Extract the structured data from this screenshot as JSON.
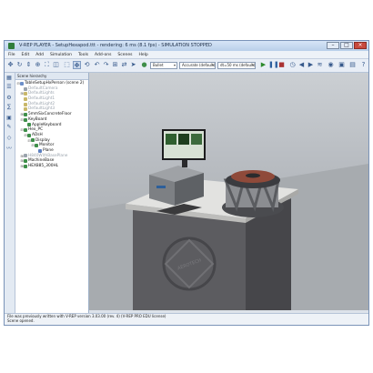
{
  "window": {
    "title": "V-REP PLAYER - SetupHexapod.ttt - rendering: 6 ms (8.1 fps) - SIMULATION STOPPED",
    "controls": [
      "–",
      "□",
      "×"
    ]
  },
  "menu": {
    "items": [
      "File",
      "Edit",
      "Add",
      "Simulation",
      "Tools",
      "Add-ons",
      "Scenes",
      "Help"
    ]
  },
  "toolbar": {
    "engine": "Bullet",
    "accuracy": "Accurate (default)",
    "timestep": "dt=50 ms (default)"
  },
  "scene_hierarchy": {
    "header": "Scene hierarchy",
    "items": [
      {
        "label": "TableSetupHxPerson (scene 2)",
        "level": 0,
        "dim": false,
        "expand": "-",
        "icon_color": "#6c8fc9"
      },
      {
        "label": "DefaultCamera",
        "level": 1,
        "dim": true,
        "expand": "",
        "icon_color": "#9aa3ad"
      },
      {
        "label": "DefaultLights",
        "level": 1,
        "dim": true,
        "expand": "+",
        "icon_color": "#c9b86a"
      },
      {
        "label": "DefaultLight1",
        "level": 1,
        "dim": true,
        "expand": "",
        "icon_color": "#c9b86a"
      },
      {
        "label": "DefaultLight2",
        "level": 1,
        "dim": true,
        "expand": "",
        "icon_color": "#c9b86a"
      },
      {
        "label": "DefaultLight3",
        "level": 1,
        "dim": true,
        "expand": "",
        "icon_color": "#c9b86a"
      },
      {
        "label": "5mmSixConcreteFloor",
        "level": 1,
        "dim": false,
        "expand": "+",
        "icon_color": "#3f8f4a"
      },
      {
        "label": "KeyBoard",
        "level": 1,
        "dim": false,
        "expand": "-",
        "icon_color": "#3f8f4a"
      },
      {
        "label": "AppleKeyboard",
        "level": 2,
        "dim": false,
        "expand": "",
        "icon_color": "#3f8f4a"
      },
      {
        "label": "Hex_PC",
        "level": 1,
        "dim": false,
        "expand": "-",
        "icon_color": "#3f8f4a"
      },
      {
        "label": "ADsH",
        "level": 2,
        "dim": false,
        "expand": "-",
        "icon_color": "#3f8f4a"
      },
      {
        "label": "Display",
        "level": 3,
        "dim": false,
        "expand": "-",
        "icon_color": "#3f8f4a"
      },
      {
        "label": "Monitor",
        "level": 4,
        "dim": false,
        "expand": "-",
        "icon_color": "#3f8f4a"
      },
      {
        "label": "Plane",
        "level": 5,
        "dim": false,
        "expand": "",
        "icon_color": "#5b7fbf"
      },
      {
        "label": "H840WithBasePlane",
        "level": 1,
        "dim": true,
        "expand": "+",
        "icon_color": "#9aa3ad"
      },
      {
        "label": "MachineBase",
        "level": 1,
        "dim": false,
        "expand": "+",
        "icon_color": "#3f8f4a"
      },
      {
        "label": "HEX885_300HL",
        "level": 1,
        "dim": false,
        "expand": "+",
        "icon_color": "#3f8f4a"
      }
    ]
  },
  "scene": {
    "brand_text": "AEROTECH",
    "colors": {
      "table_top": "#e2e2e0",
      "table_body": "#5c5c60",
      "floor": "#a7abaf"
    }
  },
  "status": {
    "line1": "File was previously written with V-REP version 3.03.00 (rev. 4) (V-REP PRO EDU license)",
    "line2": "Scene opened."
  }
}
